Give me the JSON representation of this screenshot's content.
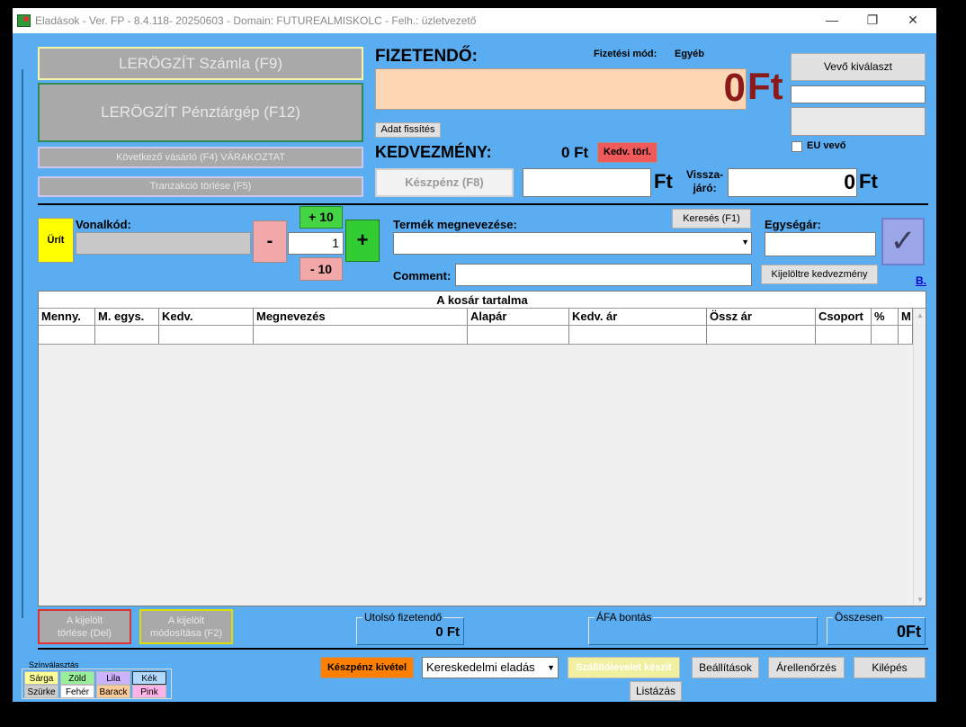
{
  "window": {
    "title": "Eladások - Ver. FP - 8.4.118- 20250603 - Domain: FUTUREALMISKOLC - Felh.: üzletvezető",
    "min": "—",
    "max": "❐",
    "close": "✕"
  },
  "buttons": {
    "lerogzit_szamla": "LERÖGZÍT Számla (F9)",
    "lerogzit_penztargep": "LERÖGZÍT Pénztárgép (F12)",
    "kovetkezo_vasarlo": "Következő vásárló (F4) VÁRAKOZTAT",
    "tranzakcio_torlese": "Tranzakció törlése  (F5)",
    "adat_frissites": "Adat fissítés",
    "kedv_torl": "Kedv. törl.",
    "keszpenz": "Készpénz (F8)",
    "vevo_kivalaszt": "Vevő kiválaszt",
    "urit": "Ürít",
    "minus": "-",
    "plus": "+",
    "plus10": "+ 10",
    "minus10": "- 10",
    "kereses": "Keresés (F1)",
    "kijeloltre_kedvezmeny": "Kijelöltre kedvezmény",
    "b_link": "B.",
    "kijelolt_torlese": "A kijelölt\ntörlése (Del)",
    "kijelolt_modositasa": "A kijelölt\nmódosítása (F2)",
    "keszpenz_kivetel": "Készpénz kivétel",
    "szallitolevelet": "Szállítólevelet készít",
    "beallitasok": "Beállítások",
    "arellenorzes": "Árellenőrzés",
    "kilepes": "Kilépés",
    "listazas": "Listázás"
  },
  "payment": {
    "fizetendo_label": "FIZETENDŐ:",
    "fizetesi_mod_label": "Fizetési mód:",
    "fizetesi_mod_value": "Egyéb",
    "amount": "0",
    "currency": "Ft",
    "kedvezmeny_label": "KEDVEZMÉNY:",
    "kedvezmeny_value": "0 Ft",
    "ft_label": "Ft",
    "visszajaro_label_1": "Vissza-",
    "visszajaro_label_2": "járó:",
    "visszajaro_value": "0",
    "visszajaro_ft": "Ft",
    "eu_vevo": "EU vevő"
  },
  "entry": {
    "vonalkod_label": "Vonalkód:",
    "quantity": "1",
    "termek_label": "Termék megnevezése:",
    "egysegar_label": "Egységár:",
    "comment_label": "Comment:",
    "checkmark": "✓"
  },
  "cart": {
    "title": "A kosár tartalma",
    "columns": [
      "Menny.",
      "M. egys.",
      "Kedv.",
      "Megnevezés",
      "Alapár",
      "Kedv. ár",
      "Össz ár",
      "Csoport",
      "%",
      "M"
    ]
  },
  "summary": {
    "utolso_label": "Utolsó fizetendő",
    "utolso_value": "0 Ft",
    "afa_label": "ÁFA bontás",
    "osszesen_label": "Összesen",
    "osszesen_value": "0Ft"
  },
  "footer": {
    "sale_type": "Kereskedelmi eladás",
    "color_title": "Színválasztás",
    "colors": [
      "Sárga",
      "Zöld",
      "Lila",
      "Kék",
      "Szürke",
      "Fehér",
      "Barack",
      "Pink"
    ],
    "color_values": [
      "#ffff99",
      "#99ee99",
      "#ccb3ff",
      "#b3d9ff",
      "#cccccc",
      "#ffffff",
      "#ffcc99",
      "#ffb3e6"
    ]
  }
}
